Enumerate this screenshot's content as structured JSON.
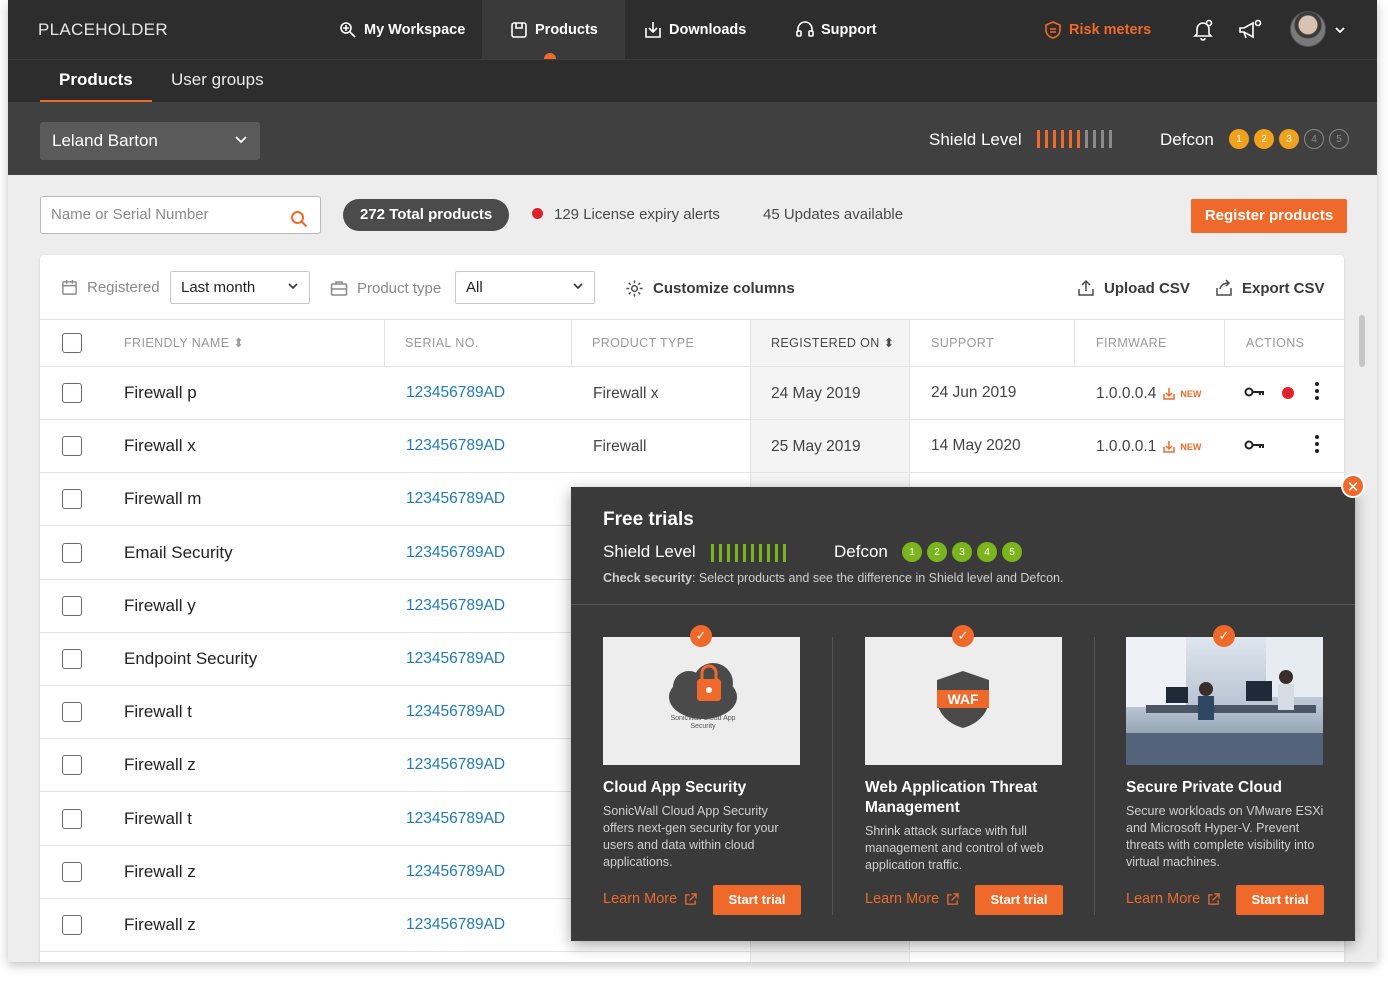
{
  "brand": "PLACEHOLDER",
  "nav": {
    "items": [
      {
        "label": "My Workspace",
        "icon": "workspace-icon"
      },
      {
        "label": "Products",
        "icon": "products-icon",
        "active": true
      },
      {
        "label": "Downloads",
        "icon": "downloads-icon"
      },
      {
        "label": "Support",
        "icon": "support-icon"
      }
    ],
    "risk_label": "Risk meters"
  },
  "subnav": {
    "tabs": [
      {
        "label": "Products",
        "active": true
      },
      {
        "label": "User groups"
      }
    ]
  },
  "account": {
    "name": "Leland Barton"
  },
  "shield": {
    "label": "Shield Level",
    "level": 6,
    "max": 10
  },
  "defcon": {
    "label": "Defcon",
    "levels": [
      "1",
      "2",
      "3",
      "4",
      "5"
    ],
    "active": 3
  },
  "toolbar": {
    "search_placeholder": "Name or Serial Number",
    "total": "272 Total products",
    "alerts": "129 License expiry alerts",
    "updates": "45 Updates available",
    "register": "Register products"
  },
  "filters": {
    "registered_label": "Registered",
    "registered_value": "Last month",
    "type_label": "Product type",
    "type_value": "All",
    "customize": "Customize columns",
    "upload": "Upload CSV",
    "export": "Export CSV"
  },
  "table": {
    "headers": [
      "FRIENDLY NAME",
      "SERIAL NO.",
      "PRODUCT TYPE",
      "REGISTERED ON",
      "SUPPORT",
      "FIRMWARE",
      "ACTIONS"
    ],
    "new_tag": "NEW",
    "rows": [
      {
        "name": "Firewall p",
        "serial": "123456789AD",
        "type": "Firewall x",
        "registered": "24 May 2019",
        "support": "24 Jun 2019",
        "firmware": "1.0.0.0.4",
        "alert": true
      },
      {
        "name": "Firewall x",
        "serial": "123456789AD",
        "type": "Firewall",
        "registered": "25 May 2019",
        "support": "14 May 2020",
        "firmware": "1.0.0.0.1",
        "alert": false
      },
      {
        "name": "Firewall m",
        "serial": "123456789AD"
      },
      {
        "name": "Email Security",
        "serial": "123456789AD"
      },
      {
        "name": "Firewall y",
        "serial": "123456789AD"
      },
      {
        "name": "Endpoint Security",
        "serial": "123456789AD"
      },
      {
        "name": "Firewall t",
        "serial": "123456789AD"
      },
      {
        "name": "Firewall z",
        "serial": "123456789AD"
      },
      {
        "name": "Firewall t",
        "serial": "123456789AD"
      },
      {
        "name": "Firewall z",
        "serial": "123456789AD"
      },
      {
        "name": "Firewall z",
        "serial": "123456789AD"
      }
    ]
  },
  "trials": {
    "title": "Free trials",
    "shield_label": "Shield Level",
    "shield_level": 10,
    "defcon_label": "Defcon",
    "defcon_levels": [
      "1",
      "2",
      "3",
      "4",
      "5"
    ],
    "hint_bold": "Check security",
    "hint_rest": ": Select products and see the difference in Shield level and Defcon.",
    "learn_label": "Learn More",
    "start_label": "Start trial",
    "cards": [
      {
        "title": "Cloud App Security",
        "desc": "SonicWall Cloud App Security offers next-gen security for your users and data within cloud applications.",
        "img_caption": "SonicWall Cloud App Security"
      },
      {
        "title": "Web Application Threat Management",
        "desc": "Shrink attack surface with full management and control of web application traffic.",
        "img_caption": "WAF"
      },
      {
        "title": "Secure Private Cloud",
        "desc": "Secure workloads on VMware ESXi and Microsoft Hyper-V. Prevent threats with complete visibility into virtual machines.",
        "img_caption": ""
      }
    ]
  },
  "colors": {
    "accent": "#ef6a2a",
    "alert": "#e0202a",
    "link": "#1f7ab8",
    "green": "#7ab51d",
    "dark": "#2d2d2d"
  }
}
